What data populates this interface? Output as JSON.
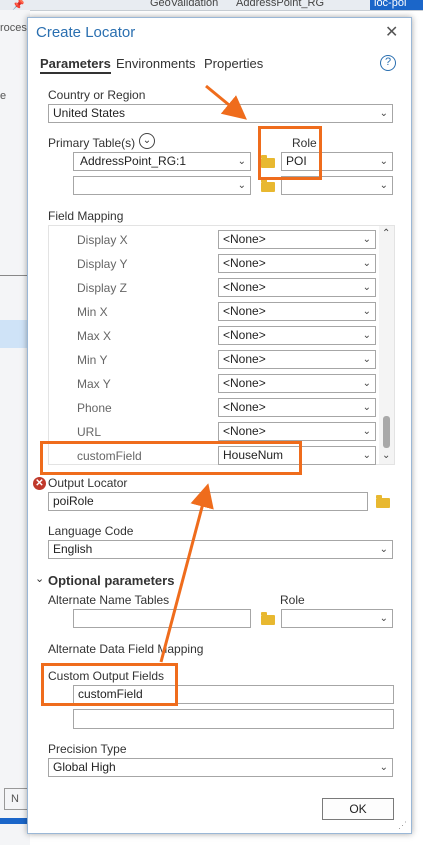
{
  "background": {
    "tabs": [
      "GeoValidation",
      "AddressPoint_RG",
      "loc-poi"
    ],
    "left_texts": [
      "roces",
      "e"
    ],
    "button_text": "N"
  },
  "dialog": {
    "title": "Create Locator",
    "tabs": [
      "Parameters",
      "Environments",
      "Properties"
    ],
    "country_label": "Country or Region",
    "country_value": "United States",
    "primary_tables_label": "Primary Table(s)",
    "role_label": "Role",
    "primary_table_1": "AddressPoint_RG:1",
    "role_1": "POI",
    "field_mapping_label": "Field Mapping",
    "mapping": [
      {
        "name": "Display X",
        "value": "<None>"
      },
      {
        "name": "Display Y",
        "value": "<None>"
      },
      {
        "name": "Display Z",
        "value": "<None>"
      },
      {
        "name": "Min X",
        "value": "<None>"
      },
      {
        "name": "Max X",
        "value": "<None>"
      },
      {
        "name": "Min Y",
        "value": "<None>"
      },
      {
        "name": "Max Y",
        "value": "<None>"
      },
      {
        "name": "Phone",
        "value": "<None>"
      },
      {
        "name": "URL",
        "value": "<None>"
      },
      {
        "name": "customField",
        "value": "HouseNum"
      }
    ],
    "output_locator_label": "Output Locator",
    "output_locator_value": "poiRole",
    "language_code_label": "Language Code",
    "language_code_value": "English",
    "optional_parameters_label": "Optional parameters",
    "alternate_name_tables_label": "Alternate Name Tables",
    "alt_role_label": "Role",
    "alternate_data_field_mapping_label": "Alternate Data Field Mapping",
    "custom_output_fields_label": "Custom Output Fields",
    "custom_output_field_1": "customField",
    "precision_type_label": "Precision Type",
    "precision_type_value": "Global High",
    "ok_label": "OK"
  },
  "colors": {
    "accent": "#2a6fb0",
    "highlight": "#ef6c1c",
    "error": "#c0392b"
  }
}
